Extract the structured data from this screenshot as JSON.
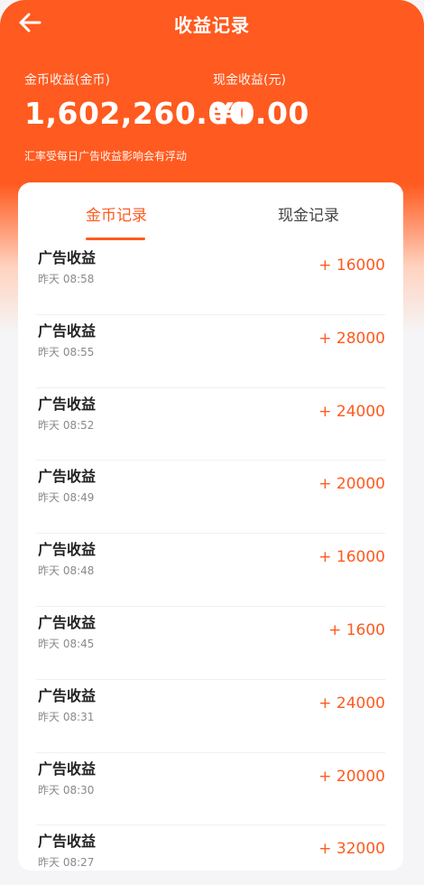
{
  "header": {
    "title": "收益记录",
    "coin_label": "金币收益(金币)",
    "coin_value": "1,602,260.00",
    "cash_label": "现金收益(元)",
    "cash_value": "¥0.00",
    "note": "汇率受每日广告收益影响会有浮动"
  },
  "tabs": [
    {
      "label": "金币记录",
      "active": true
    },
    {
      "label": "现金记录",
      "active": false
    }
  ],
  "records": [
    {
      "title": "广告收益",
      "time": "昨天 08:58",
      "amount": "+ 16000"
    },
    {
      "title": "广告收益",
      "time": "昨天 08:55",
      "amount": "+ 28000"
    },
    {
      "title": "广告收益",
      "time": "昨天 08:52",
      "amount": "+ 24000"
    },
    {
      "title": "广告收益",
      "time": "昨天 08:49",
      "amount": "+ 20000"
    },
    {
      "title": "广告收益",
      "time": "昨天 08:48",
      "amount": "+ 16000"
    },
    {
      "title": "广告收益",
      "time": "昨天 08:45",
      "amount": "+ 1600"
    },
    {
      "title": "广告收益",
      "time": "昨天 08:31",
      "amount": "+ 24000"
    },
    {
      "title": "广告收益",
      "time": "昨天 08:30",
      "amount": "+ 20000"
    },
    {
      "title": "广告收益",
      "time": "昨天 08:27",
      "amount": "+ 32000"
    }
  ],
  "colors": {
    "accent": "#ff5a1f",
    "text": "#222222",
    "muted": "#8a8a8a"
  },
  "icons": {
    "back": "arrow-left-icon"
  }
}
